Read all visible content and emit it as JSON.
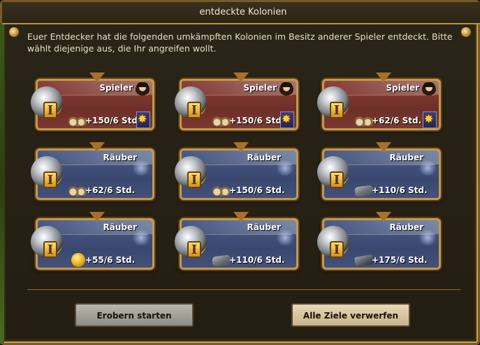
{
  "window": {
    "title": "entdeckte Kolonien",
    "intro": "Euer Entdecker hat die folgenden umkämpften Kolonien im Besitz anderer Spieler entdeckt. Bitte wählt diejenige aus, die Ihr angreifen wollt."
  },
  "colonies": [
    {
      "type_label": "Spieler",
      "level": "I",
      "resource_icon": "wood-icon",
      "amount": "+150/6 Std.",
      "kind": "player"
    },
    {
      "type_label": "Spieler",
      "level": "I",
      "resource_icon": "wood-icon",
      "amount": "+150/6 Std.",
      "kind": "player"
    },
    {
      "type_label": "Spieler",
      "level": "I",
      "resource_icon": "wood-icon",
      "amount": "+62/6 Std.",
      "kind": "player"
    },
    {
      "type_label": "Räuber",
      "level": "I",
      "resource_icon": "wood-icon",
      "amount": "+62/6 Std.",
      "kind": "bandit"
    },
    {
      "type_label": "Räuber",
      "level": "I",
      "resource_icon": "wood-icon",
      "amount": "+150/6 Std.",
      "kind": "bandit"
    },
    {
      "type_label": "Räuber",
      "level": "I",
      "resource_icon": "stone-icon",
      "amount": "+110/6 Std.",
      "kind": "bandit"
    },
    {
      "type_label": "Räuber",
      "level": "I",
      "resource_icon": "gold-icon",
      "amount": "+55/6 Std.",
      "kind": "bandit"
    },
    {
      "type_label": "Räuber",
      "level": "I",
      "resource_icon": "stone-icon",
      "amount": "+110/6 Std.",
      "kind": "bandit"
    },
    {
      "type_label": "Räuber",
      "level": "I",
      "resource_icon": "ore-icon",
      "amount": "+175/6 Std.",
      "kind": "bandit"
    }
  ],
  "buttons": {
    "conquer": "Erobern starten",
    "discard_all": "Alle Ziele verwerfen"
  },
  "colors": {
    "player_card": "#7a3a30",
    "bandit_card": "#3a4870",
    "frame_gold": "#c39a4c"
  }
}
